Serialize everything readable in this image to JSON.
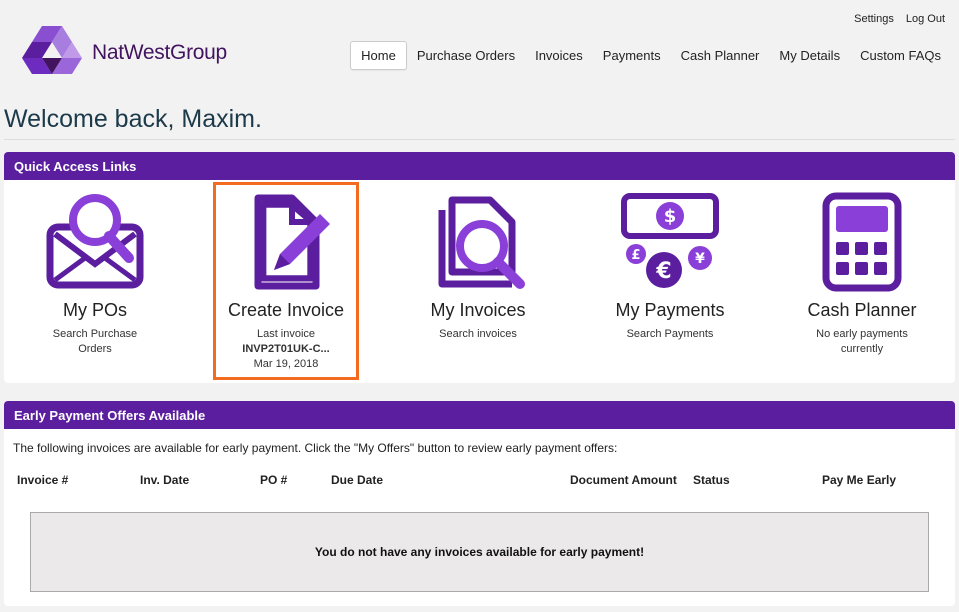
{
  "header": {
    "brand": "NatWest Group",
    "brand_part1": "NatWest",
    "brand_part2": "Group",
    "settings_label": "Settings",
    "logout_label": "Log Out"
  },
  "nav": {
    "items": [
      "Home",
      "Purchase Orders",
      "Invoices",
      "Payments",
      "Cash Planner",
      "My Details",
      "Custom FAQs"
    ],
    "active": "Home"
  },
  "welcome": "Welcome back, Maxim.",
  "quick_access": {
    "title": "Quick Access Links",
    "tiles": [
      {
        "title": "My POs",
        "sub1": "Search Purchase",
        "sub2": "Orders",
        "icon": "envelope-search-icon"
      },
      {
        "title": "Create Invoice",
        "sub1": "Last invoice",
        "sub2": "INVP2T01UK-C...",
        "sub3": "Mar 19, 2018",
        "icon": "document-pencil-icon"
      },
      {
        "title": "My Invoices",
        "sub1": "Search invoices",
        "icon": "document-search-icon"
      },
      {
        "title": "My Payments",
        "sub1": "Search Payments",
        "icon": "currency-icon"
      },
      {
        "title": "Cash Planner",
        "sub1": "No early payments",
        "sub2": "currently",
        "icon": "calculator-icon"
      }
    ]
  },
  "early_payment": {
    "title": "Early Payment Offers Available",
    "description": "The following invoices are available for early payment. Click the \"My Offers\" button to review early payment offers:",
    "columns": [
      "Invoice #",
      "Inv. Date",
      "PO #",
      "Due Date",
      "Document Amount",
      "Status",
      "Pay Me Early"
    ],
    "empty_message": "You do not have any invoices available for early payment!"
  },
  "colors": {
    "brand_purple": "#5a1e9e",
    "highlight_orange": "#f26b21"
  }
}
